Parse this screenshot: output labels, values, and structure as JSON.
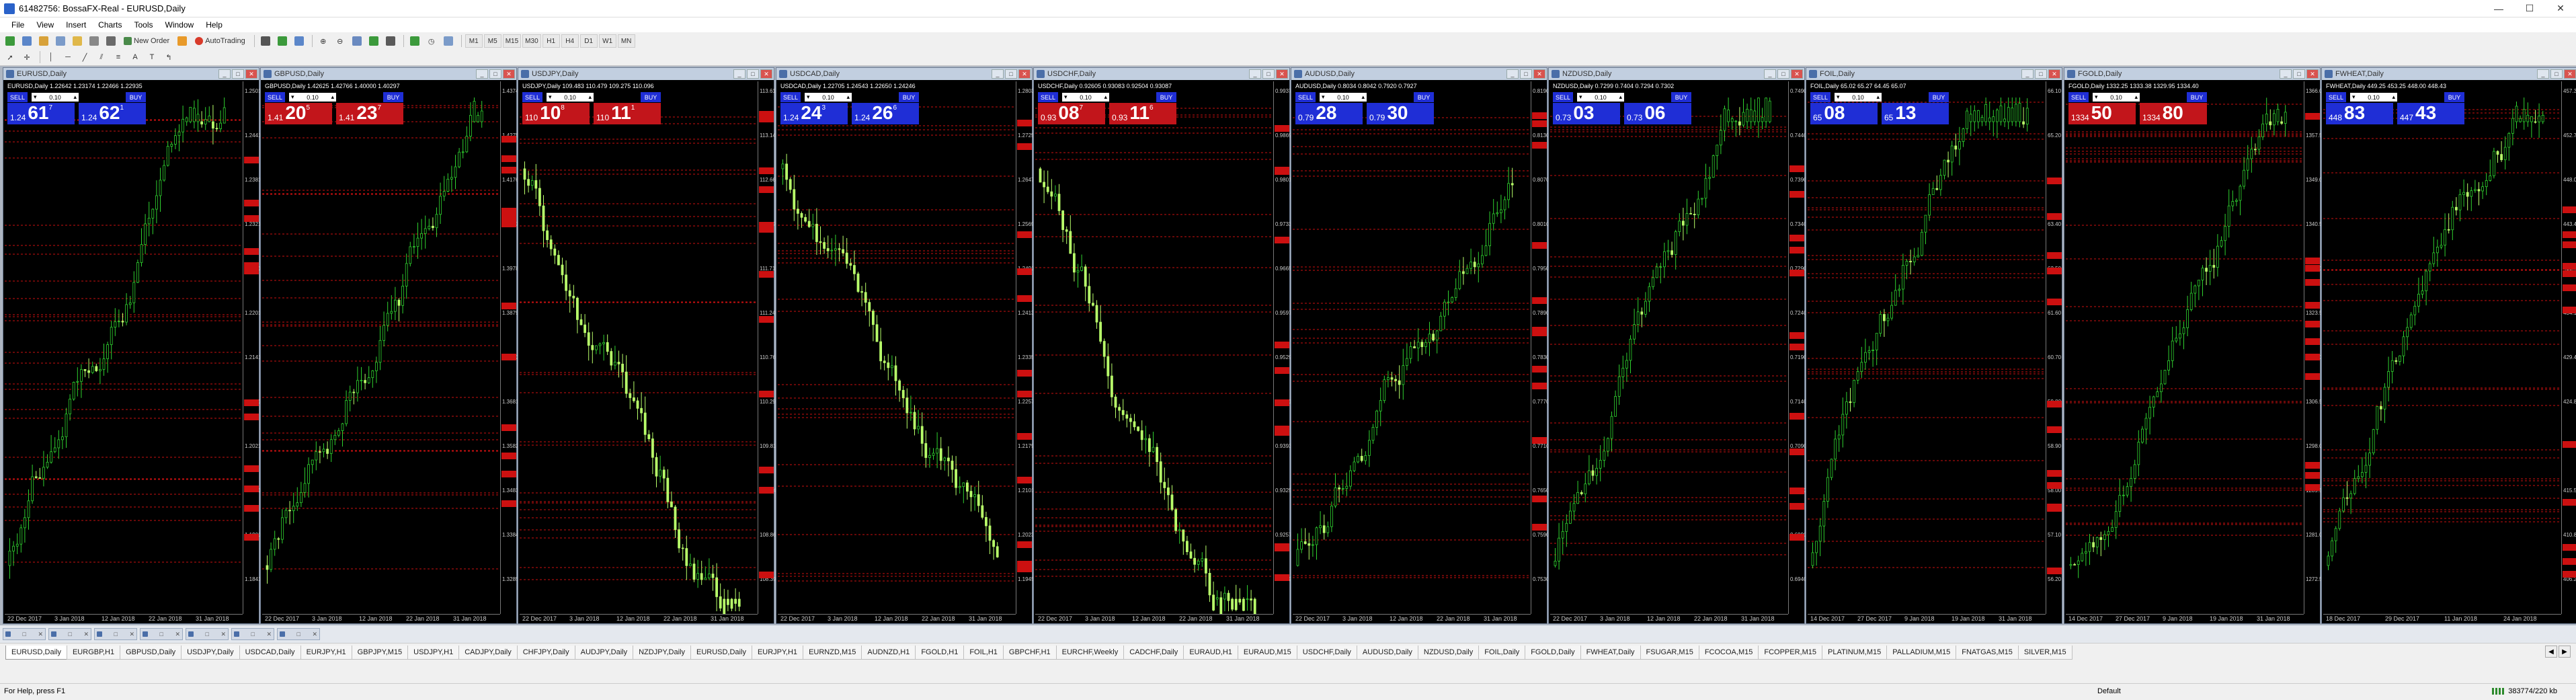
{
  "window": {
    "title": "61482756: BossaFX-Real - EURUSD,Daily",
    "min": "—",
    "max": "☐",
    "close": "✕"
  },
  "menu": [
    "File",
    "View",
    "Insert",
    "Charts",
    "Tools",
    "Window",
    "Help"
  ],
  "toolbar": {
    "new_order": "New Order",
    "autotrading": "AutoTrading",
    "timeframes": [
      "M1",
      "M5",
      "M15",
      "M30",
      "H1",
      "H4",
      "D1",
      "W1",
      "MN"
    ]
  },
  "colors": {
    "sell": "#1f2ed6",
    "buy_blue": "#1f2ed6",
    "red_panel": "#c2151b",
    "candle_up": "#2fd12f",
    "candle_down": "#b8ff6a",
    "level": "#cc1010"
  },
  "charts": [
    {
      "title": "EURUSD,Daily",
      "info": "EURUSD,Daily 1.22642 1.23174 1.22466 1.22935",
      "lot": "0.10",
      "sell_small": "1.24",
      "sell_big": "61",
      "sell_sup": "7",
      "buy_small": "1.24",
      "buy_big": "62",
      "buy_sup": "1",
      "panel": "blue",
      "prices": [
        "1.25010",
        "1.24410",
        "1.23810",
        "1.23210",
        "1.22610",
        "1.22010",
        "1.21410",
        "1.20810",
        "1.20210",
        "1.19610",
        "1.19010",
        "1.18410"
      ],
      "dates": [
        "22 Dec 2017",
        "3 Jan 2018",
        "12 Jan 2018",
        "22 Jan 2018",
        "31 Jan 2018"
      ],
      "trend": "up"
    },
    {
      "title": "GBPUSD,Daily",
      "info": "GBPUSD,Daily 1.42625 1.42766 1.40000 1.40297",
      "lot": "0.10",
      "sell_small": "1.41",
      "sell_big": "20",
      "sell_sup": "5",
      "buy_small": "1.41",
      "buy_big": "23",
      "buy_sup": "7",
      "panel": "red",
      "prices": [
        "1.43740",
        "1.42750",
        "1.41760",
        "1.40770",
        "1.39780",
        "1.38790",
        "1.37800",
        "1.36810",
        "1.35820",
        "1.34830",
        "1.33840",
        "1.32850"
      ],
      "dates": [
        "22 Dec 2017",
        "3 Jan 2018",
        "12 Jan 2018",
        "22 Jan 2018",
        "31 Jan 2018"
      ],
      "trend": "up"
    },
    {
      "title": "USDJPY,Daily",
      "info": "USDJPY,Daily 109.483 110.479 109.275 110.096",
      "lot": "0.10",
      "sell_small": "110",
      "sell_big": "10",
      "sell_sup": "8",
      "buy_small": "110",
      "buy_big": "11",
      "buy_sup": "1",
      "panel": "red",
      "prices": [
        "113.615",
        "113.140",
        "112.665",
        "112.190",
        "111.715",
        "111.240",
        "110.765",
        "110.290",
        "109.815",
        "109.340",
        "108.865",
        "108.390"
      ],
      "dates": [
        "22 Dec 2017",
        "3 Jan 2018",
        "12 Jan 2018",
        "22 Jan 2018",
        "31 Jan 2018"
      ],
      "trend": "down"
    },
    {
      "title": "USDCAD,Daily",
      "info": "USDCAD,Daily 1.22705 1.24543 1.22650 1.24246",
      "lot": "0.10",
      "sell_small": "1.24",
      "sell_big": "24",
      "sell_sup": "3",
      "buy_small": "1.24",
      "buy_big": "26",
      "buy_sup": "6",
      "panel": "blue",
      "prices": [
        "1.28030",
        "1.27250",
        "1.26470",
        "1.25690",
        "1.24910",
        "1.24130",
        "1.23350",
        "1.22570",
        "1.21790",
        "1.21010",
        "1.20230",
        "1.19450"
      ],
      "dates": [
        "22 Dec 2017",
        "3 Jan 2018",
        "12 Jan 2018",
        "22 Jan 2018",
        "31 Jan 2018"
      ],
      "trend": "down"
    },
    {
      "title": "USDCHF,Daily",
      "info": "USDCHF,Daily 0.92605 0.93083 0.92504 0.93087",
      "lot": "0.10",
      "sell_small": "0.93",
      "sell_big": "08",
      "sell_sup": "7",
      "buy_small": "0.93",
      "buy_big": "11",
      "buy_sup": "6",
      "panel": "red",
      "prices": [
        "0.99370",
        "0.98690",
        "0.98010",
        "0.97330",
        "0.96650",
        "0.95970",
        "0.95290",
        "0.94610",
        "0.93930",
        "0.93250",
        "0.92570",
        "0.91890"
      ],
      "dates": [
        "22 Dec 2017",
        "3 Jan 2018",
        "12 Jan 2018",
        "22 Jan 2018",
        "31 Jan 2018"
      ],
      "trend": "down"
    },
    {
      "title": "AUDUSD,Daily",
      "info": "AUDUSD,Daily 0.8034 0.8042 0.7920 0.7927",
      "lot": "0.10",
      "sell_small": "0.79",
      "sell_big": "28",
      "sell_sup": "",
      "buy_small": "0.79",
      "buy_big": "30",
      "buy_sup": "",
      "panel": "blue",
      "prices": [
        "0.8190",
        "0.8130",
        "0.8070",
        "0.8010",
        "0.7950",
        "0.7890",
        "0.7830",
        "0.7770",
        "0.7710",
        "0.7650",
        "0.7590",
        "0.7530"
      ],
      "dates": [
        "22 Dec 2017",
        "3 Jan 2018",
        "12 Jan 2018",
        "22 Jan 2018",
        "31 Jan 2018"
      ],
      "trend": "up"
    },
    {
      "title": "NZDUSD,Daily",
      "info": "NZDUSD,Daily 0.7299 0.7404 0.7294 0.7302",
      "lot": "0.10",
      "sell_small": "0.73",
      "sell_big": "03",
      "sell_sup": "",
      "buy_small": "0.73",
      "buy_big": "06",
      "buy_sup": "",
      "panel": "blue",
      "prices": [
        "0.7490",
        "0.7440",
        "0.7390",
        "0.7340",
        "0.7290",
        "0.7240",
        "0.7190",
        "0.7140",
        "0.7090",
        "0.7040",
        "0.6990",
        "0.6940"
      ],
      "dates": [
        "22 Dec 2017",
        "3 Jan 2018",
        "12 Jan 2018",
        "22 Jan 2018",
        "31 Jan 2018"
      ],
      "trend": "up"
    },
    {
      "title": "FOIL,Daily",
      "info": "FOIL,Daily 65.02 65.27 64.45 65.07",
      "lot": "0.10",
      "sell_small": "65",
      "sell_big": "08",
      "sell_sup": "",
      "buy_small": "65",
      "buy_big": "13",
      "buy_sup": "",
      "panel": "blue",
      "prices": [
        "66.10",
        "65.20",
        "64.30",
        "63.40",
        "62.50",
        "61.60",
        "60.70",
        "59.80",
        "58.90",
        "58.00",
        "57.10",
        "56.20"
      ],
      "dates": [
        "14 Dec 2017",
        "27 Dec 2017",
        "9 Jan 2018",
        "19 Jan 2018",
        "31 Jan 2018"
      ],
      "trend": "up"
    },
    {
      "title": "FGOLD,Daily",
      "info": "FGOLD,Daily 1332.25 1333.38 1329.95 1334.40",
      "lot": "0.10",
      "sell_small": "1334",
      "sell_big": "50",
      "sell_sup": "",
      "buy_small": "1334",
      "buy_big": "80",
      "buy_sup": "",
      "panel": "red",
      "prices": [
        "1366.00",
        "1357.50",
        "1349.00",
        "1340.50",
        "1332.00",
        "1323.50",
        "1315.00",
        "1306.50",
        "1298.00",
        "1289.50",
        "1281.00",
        "1272.50"
      ],
      "dates": [
        "14 Dec 2017",
        "27 Dec 2017",
        "9 Jan 2018",
        "19 Jan 2018",
        "31 Jan 2018"
      ],
      "trend": "up"
    },
    {
      "title": "FWHEAT,Daily",
      "info": "FWHEAT,Daily 449.25 453.25 448.00 448.43",
      "lot": "0.10",
      "sell_small": "448",
      "sell_big": "83",
      "sell_sup": "",
      "buy_small": "447",
      "buy_big": "43",
      "buy_sup": "",
      "panel": "blue",
      "prices": [
        "457.35",
        "452.70",
        "448.05",
        "443.40",
        "438.75",
        "434.10",
        "429.45",
        "424.80",
        "420.15",
        "415.50",
        "410.85",
        "406.20"
      ],
      "dates": [
        "18 Dec 2017",
        "29 Dec 2017",
        "11 Jan 2018",
        "24 Jan 2018"
      ],
      "trend": "up"
    }
  ],
  "symbol_tabs": [
    "EURUSD,Daily",
    "EURGBP,H1",
    "GBPUSD,Daily",
    "USDJPY,Daily",
    "USDCAD,Daily",
    "EURJPY,H1",
    "GBPJPY,M15",
    "USDJPY,H1",
    "CADJPY,Daily",
    "CHFJPY,Daily",
    "AUDJPY,Daily",
    "NZDJPY,Daily",
    "EURUSD,Daily",
    "EURJPY,H1",
    "EURNZD,M15",
    "AUDNZD,H1",
    "FGOLD,H1",
    "FOIL,H1",
    "GBPCHF,H1",
    "EURCHF,Weekly",
    "CADCHF,Daily",
    "EURAUD,H1",
    "EURAUD,M15",
    "USDCHF,Daily",
    "AUDUSD,Daily",
    "NZDUSD,Daily",
    "FOIL,Daily",
    "FGOLD,Daily",
    "FWHEAT,Daily",
    "FSUGAR,M15",
    "FCOCOA,M15",
    "FCOPPER,M15",
    "PLATINUM,M15",
    "PALLADIUM,M15",
    "FNATGAS,M15",
    "SILVER,M15"
  ],
  "status": {
    "help": "For Help, press F1",
    "profile": "Default",
    "traffic": "383774/220 kb"
  }
}
